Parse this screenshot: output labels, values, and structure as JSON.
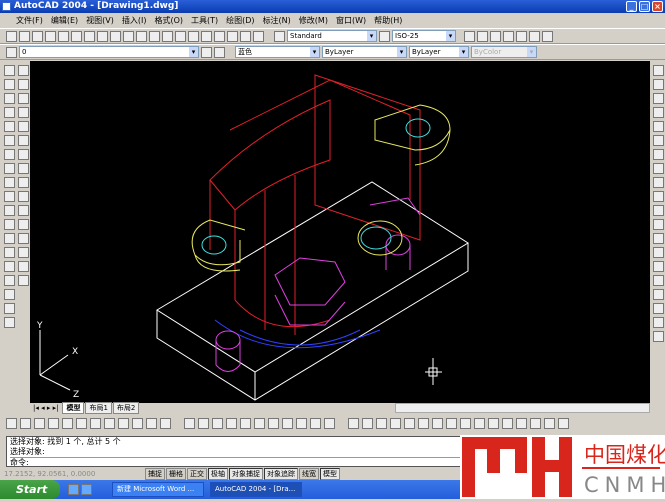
{
  "window": {
    "title": "AutoCAD 2004 - [Drawing1.dwg]"
  },
  "menu": [
    "文件(F)",
    "编辑(E)",
    "视图(V)",
    "插入(I)",
    "格式(O)",
    "工具(T)",
    "绘图(D)",
    "标注(N)",
    "修改(M)",
    "窗口(W)",
    "帮助(H)"
  ],
  "toolbar": {
    "text_style": "Standard",
    "dim_style": "ISO-25",
    "layer": "0",
    "color": "蓝色",
    "linetype": "ByLayer",
    "lineweight": "ByLayer",
    "plotstyle": "ByColor"
  },
  "tabs": [
    "模型",
    "布局1",
    "布局2"
  ],
  "ucs": {
    "x": "X",
    "y": "Y",
    "z": "Z"
  },
  "command": {
    "lines": [
      "选择对象: 找到 1 个, 总计 5 个",
      "选择对象:",
      "命令:"
    ]
  },
  "status": {
    "coords": "17.2152, 92.0561, 0.0000",
    "buttons": [
      {
        "label": "捕捉",
        "on": false
      },
      {
        "label": "栅格",
        "on": false
      },
      {
        "label": "正交",
        "on": false
      },
      {
        "label": "极轴",
        "on": true
      },
      {
        "label": "对象捕捉",
        "on": true
      },
      {
        "label": "对象追踪",
        "on": true
      },
      {
        "label": "线宽",
        "on": false
      },
      {
        "label": "模型",
        "on": true
      }
    ]
  },
  "taskbar": {
    "start": "Start",
    "tasks": [
      "新建 Microsoft Word ...",
      "AutoCAD 2004 - [Dra..."
    ]
  },
  "logo": {
    "cn": "中国煤化工",
    "en": "CNMHG",
    "mark": "MH"
  },
  "colors": {
    "title": "#0a3cb0",
    "drawing_bg": "#000000",
    "logo_red": "#d9261c"
  }
}
